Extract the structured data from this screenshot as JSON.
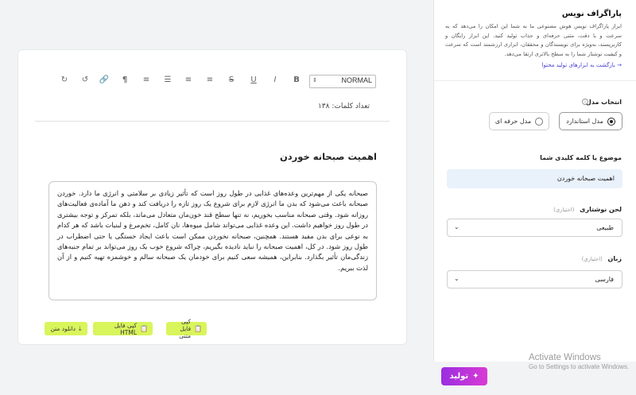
{
  "editor": {
    "format_select": "NORMAL",
    "toolbar_icons": [
      "redo-icon",
      "undo-icon",
      "link-icon",
      "rtl-paragraph-icon",
      "align-right-icon",
      "ordered-list-icon",
      "align-center-icon",
      "align-left-icon",
      "strikethrough-icon",
      "underline-icon",
      "italic-icon",
      "bold-icon"
    ],
    "word_count": "تعداد کلمات: ۱۳۸",
    "title": "اهمیت صبحانه خوردن",
    "body": "صبحانه یکی از مهم‌ترین وعده‌های غذایی در طول روز است که تأثیر زیادی بر سلامتی و انرژی ما دارد. خوردن صبحانه باعث می‌شود که بدن ما انرژی لازم برای شروع یک روز تازه را دریافت کند و ذهن ما آماده‌ی فعالیت‌های روزانه شود. وقتی صبحانه مناسب بخوریم، نه تنها سطح قند خون‌مان متعادل می‌ماند، بلکه تمرکز و توجه بیشتری در طول روز خواهیم داشت. این وعده غذایی می‌تواند شامل میوه‌ها، نان کامل، تخم‌مرغ و لبنیات باشد که هر کدام به نوعی برای بدن مفید هستند. همچنین، صبحانه نخوردن ممکن است باعث ایجاد خستگی یا حتی اضطراب در طول روز شود. در کل، اهمیت صبحانه را نباید نادیده بگیریم، چراکه شروع خوب یک روز می‌تواند بر تمام جنبه‌های زندگی‌مان تأثیر بگذارد. بنابراین، همیشه سعی کنیم برای خودمان یک صبحانه سالم و خوشمزه تهیه کنیم و از آن لذت ببریم.",
    "actions": {
      "copy_text": "کپی فایل متنی",
      "copy_html": "کپی فایل HTML",
      "download_text": "دانلود متن"
    }
  },
  "panel": {
    "title": "پاراگراف نویس",
    "description": "ابزار پاراگراف نویس هوش مصنوعی ما به شما این امکان را می‌دهد که به سرعت و با دقت، متنی حرفه‌ای و جذاب تولید کنید. این ابزار رایگان و کاربرپسند، به‌ویژه برای نویسندگان و محققان، ابزاری ارزشمند است که سرعت و کیفیت نوشتار شما را به سطح بالاتری ارتقا می‌دهد.",
    "back_link": "بازگشت به ابزارهای تولید محتوا",
    "model_label": "انتخاب مدل",
    "model_options": [
      "مدل استاندارد",
      "مدل حرفه ای"
    ],
    "model_selected": "مدل استاندارد",
    "keyword_label": "موضوع یا کلمه کلیدی شما",
    "keyword_value": "اهمیت صبحانه خوردن",
    "tone_label": "لحن نوشتاری",
    "tone_hint": "(اختیاری)",
    "tone_value": "طبیعی",
    "language_label": "زبان",
    "language_hint": "(اختیاری)",
    "language_value": "فارسی",
    "generate_label": "تولید"
  },
  "watermark": {
    "line1": "Activate Windows",
    "line2": "Go to Settings to activate Windows."
  },
  "colors": {
    "accent_lime": "#d8f55c",
    "generate_gradient_start": "#9a2ee0",
    "generate_gradient_end": "#d93bd4",
    "link": "#4a3fd0",
    "keyword_bg": "#e9f1fb"
  }
}
